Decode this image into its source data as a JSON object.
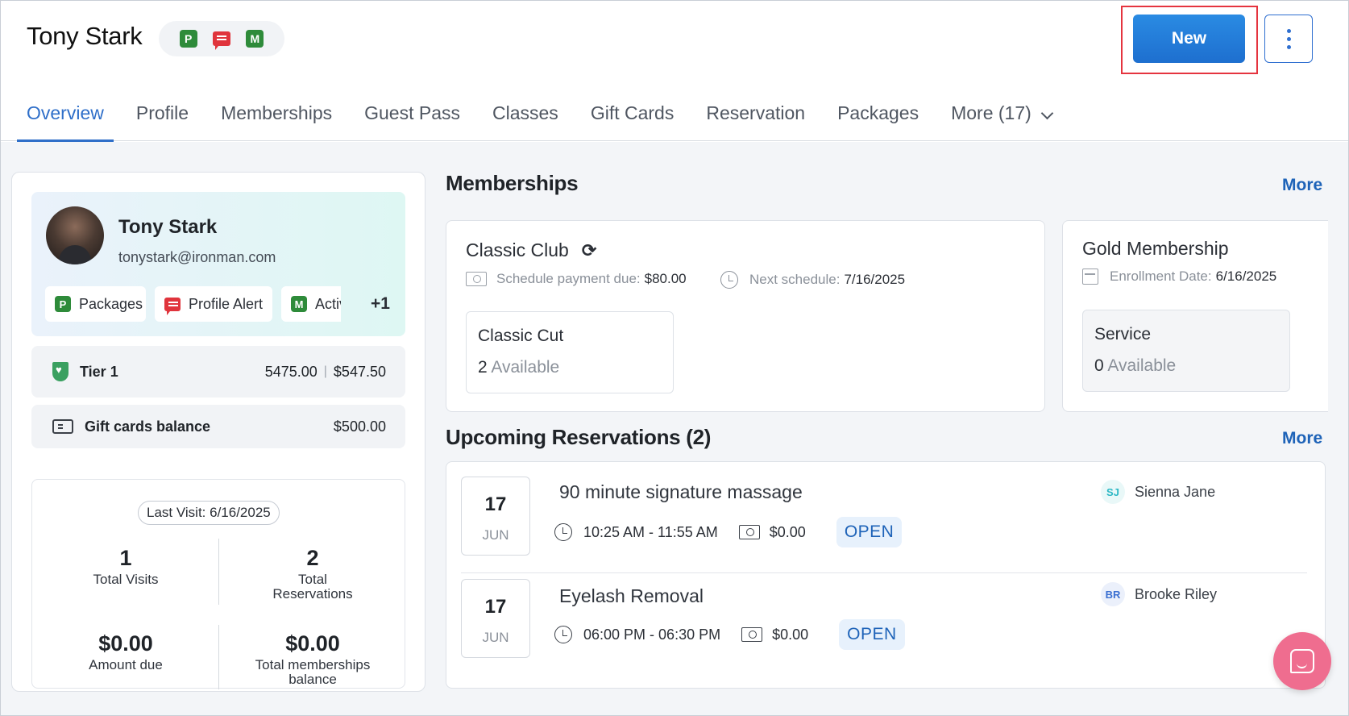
{
  "header": {
    "client_name": "Tony Stark",
    "badges": [
      "P",
      "M"
    ],
    "new_label": "New"
  },
  "tabs": [
    {
      "label": "Overview",
      "active": true
    },
    {
      "label": "Profile"
    },
    {
      "label": "Memberships"
    },
    {
      "label": "Guest Pass"
    },
    {
      "label": "Classes"
    },
    {
      "label": "Gift Cards"
    },
    {
      "label": "Reservation"
    },
    {
      "label": "Packages"
    },
    {
      "label": "More (17)"
    }
  ],
  "profile": {
    "name": "Tony Stark",
    "email": "tonystark@ironman.com",
    "chips": [
      {
        "badge": "P",
        "label": "Packages"
      },
      {
        "label": "Profile Alert"
      },
      {
        "badge": "M",
        "label": "Active Membership"
      }
    ],
    "extra_count": "+1"
  },
  "tier": {
    "label": "Tier 1",
    "points": "5475.00",
    "value": "$547.50"
  },
  "gift_cards": {
    "label": "Gift cards balance",
    "value": "$500.00"
  },
  "visits": {
    "last_visit": "Last Visit: 6/16/2025",
    "total_visits": "1",
    "total_visits_label": "Total Visits",
    "total_reservations": "2",
    "total_reservations_label": "Total Reservations",
    "amount_due": "$0.00",
    "amount_due_label": "Amount due",
    "memberships_balance": "$0.00",
    "memberships_balance_label": "Total memberships balance"
  },
  "memberships": {
    "title": "Memberships",
    "more": "More",
    "items": [
      {
        "name": "Classic Club",
        "payment_label": "Schedule payment due:",
        "payment_value": "$80.00",
        "next_label": "Next schedule:",
        "next_value": "7/16/2025",
        "service": "Classic Cut",
        "available_count": "2",
        "available_label": "Available"
      },
      {
        "name": "Gold Membership",
        "enroll_label": "Enrollment Date:",
        "enroll_value": "6/16/2025",
        "service": "Service",
        "available_count": "0",
        "available_label": "Available"
      }
    ]
  },
  "reservations": {
    "title": "Upcoming Reservations (2)",
    "more": "More",
    "items": [
      {
        "day": "17",
        "month": "JUN",
        "title": "90 minute signature massage",
        "time": "10:25 AM - 11:55 AM",
        "price": "$0.00",
        "status": "OPEN",
        "staff_initials": "SJ",
        "staff_name": "Sienna Jane"
      },
      {
        "day": "17",
        "month": "JUN",
        "title": "Eyelash Removal",
        "time": "06:00 PM - 06:30 PM",
        "price": "$0.00",
        "status": "OPEN",
        "staff_initials": "BR",
        "staff_name": "Brooke Riley"
      }
    ]
  }
}
